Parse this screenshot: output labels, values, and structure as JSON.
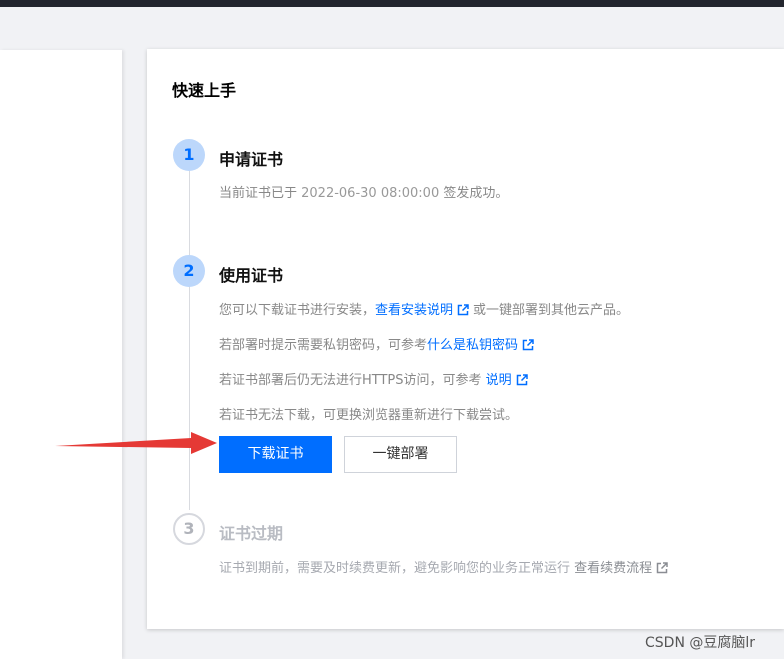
{
  "card": {
    "title": "快速上手"
  },
  "steps": [
    {
      "number": "1",
      "title": "申请证书",
      "desc": {
        "prefix": "当前证书已于 ",
        "date": "2022-06-30 08:00:00",
        "suffix": " 签发成功。"
      }
    },
    {
      "number": "2",
      "title": "使用证书",
      "line1": {
        "text": "您可以下载证书进行安装，",
        "link": "查看安装说明",
        "suffix": "或一键部署到其他云产品。"
      },
      "line2": {
        "text": "若部署时提示需要私钥密码，可参考",
        "link": "什么是私钥密码"
      },
      "line3": {
        "text": "若证书部署后仍无法进行HTTPS访问，可参考 ",
        "link": "说明"
      },
      "line4": {
        "text": "若证书无法下载，可更换浏览器重新进行下载尝试。"
      },
      "buttons": {
        "download": "下载证书",
        "deploy": "一键部署"
      }
    },
    {
      "number": "3",
      "title": "证书过期",
      "desc": {
        "text": "证书到期前，需要及时续费更新，避免影响您的业务正常运行 ",
        "link": "查看续费流程"
      }
    }
  ],
  "watermark": "CSDN @豆腐脑lr",
  "colors": {
    "primary": "#006eff",
    "step_active_bg": "#bcd7fb",
    "arrow": "#e53935"
  },
  "icons": {
    "external_link": "external-link-icon",
    "annotation_arrow": "arrow-icon"
  }
}
